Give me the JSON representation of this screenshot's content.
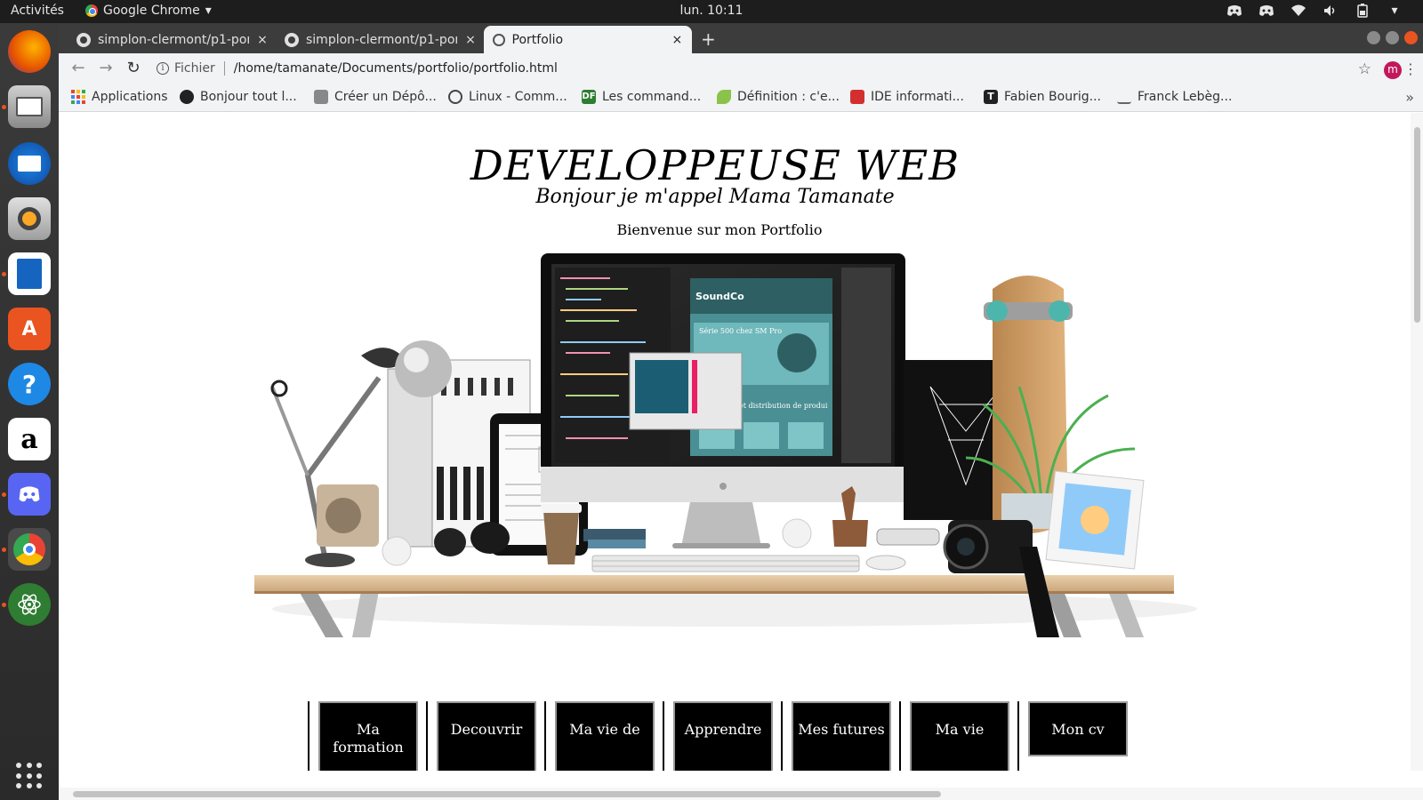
{
  "topbar": {
    "activities": "Activités",
    "app_name": "Google Chrome",
    "app_arrow": "▾",
    "clock": "lun. 10:11",
    "tray_icons": [
      "discord-icon",
      "discord-icon",
      "wifi-icon",
      "volume-icon",
      "battery-icon",
      "dropdown-arrow-icon"
    ]
  },
  "dock": {
    "items": [
      "firefox",
      "files",
      "thunderbird",
      "rhythmbox",
      "libreoffice-writer",
      "ubuntu-software",
      "help",
      "amazon",
      "discord",
      "chrome",
      "atom"
    ]
  },
  "tabs": [
    {
      "title": "simplon-clermont/p1-por",
      "icon": "github-icon",
      "close": "×"
    },
    {
      "title": "simplon-clermont/p1-por",
      "icon": "github-icon",
      "close": "×"
    },
    {
      "title": "Portfolio",
      "icon": "globe-icon",
      "close": "×",
      "active": true
    }
  ],
  "new_tab": "+",
  "toolbar": {
    "back": "←",
    "forward": "→",
    "reload": "↻",
    "scheme_label": "Fichier",
    "url": "/home/tamanate/Documents/portfolio/portfolio.html",
    "star": "☆",
    "avatar_letter": "m",
    "menu": "⋮"
  },
  "bookmarks": [
    {
      "label": "Applications"
    },
    {
      "label": "Bonjour tout l..."
    },
    {
      "label": "Créer un Dépô..."
    },
    {
      "label": "Linux - Comm..."
    },
    {
      "label": "Les command..."
    },
    {
      "label": "Définition : c'e..."
    },
    {
      "label": "IDE informati..."
    },
    {
      "label": "Fabien Bourig..."
    },
    {
      "label": "Franck Lebèg..."
    }
  ],
  "bookmarks_more": "»",
  "page": {
    "title": "DEVELOPPEUSE WEB",
    "subtitle": "Bonjour je m'appel Mama Tamanate",
    "intro": "Bienvenue sur mon Portfolio",
    "screen_texts": {
      "brand": "SoundCo",
      "promo": "Série 500 chez SM Pro",
      "promo2": "et distribution de produi"
    },
    "nav": [
      "Ma formation",
      "Decouvrir",
      "Ma vie de",
      "Apprendre",
      "Mes futures",
      "Ma vie",
      "Mon cv"
    ]
  },
  "colors": {
    "accent": "#e95420",
    "page_bg": "#ffffff",
    "menu_bg": "#000000"
  }
}
